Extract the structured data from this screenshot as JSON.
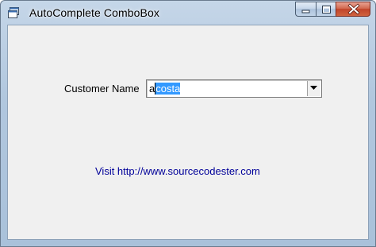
{
  "window": {
    "title": "AutoComplete ComboBox",
    "icons": {
      "app": "app-window-icon",
      "minimize": "minimize-icon",
      "maximize": "maximize-icon",
      "close": "close-icon"
    }
  },
  "form": {
    "customer_label": "Customer Name",
    "combo": {
      "typed_text": "a",
      "autocomplete_selected_text": "costa",
      "dropdown_icon": "chevron-down-icon"
    },
    "link_text": "Visit http://www.sourcecodester.com",
    "link_color": "#000099"
  },
  "colors": {
    "selection": "#3399ff",
    "client_background": "#f0f0f0"
  }
}
